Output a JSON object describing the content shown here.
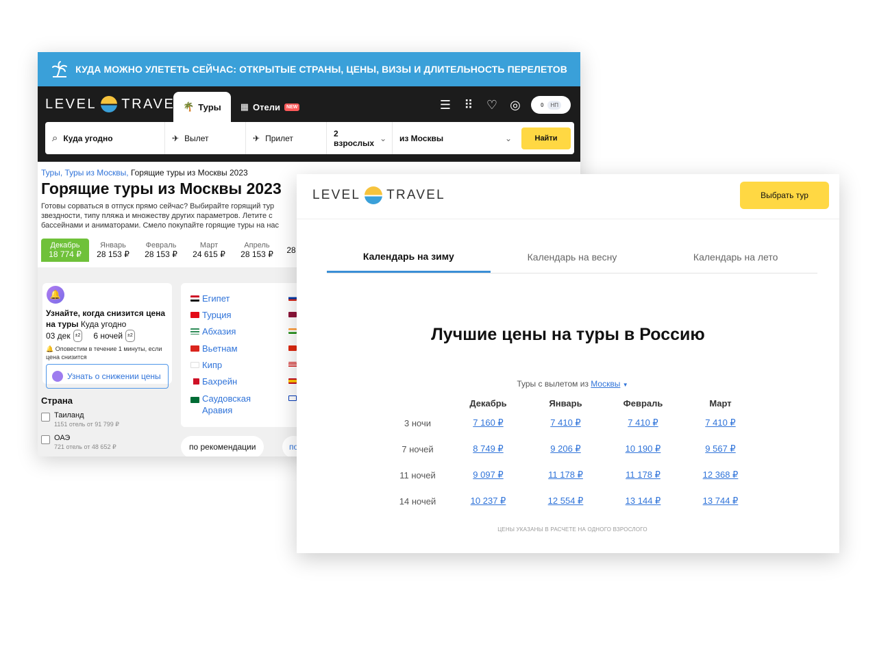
{
  "back_window": {
    "promo_banner": "КУДА МОЖНО УЛЕТЕТЬ СЕЙЧАС: ОТКРЫТЫЕ СТРАНЫ, ЦЕНЫ, ВИЗЫ И ДЛИТЕЛЬНОСТЬ ПЕРЕЛЕТОВ",
    "logo_left": "LEVEL",
    "logo_right": "TRAVEL",
    "tabs": {
      "tours": "Туры",
      "hotels": "Отели",
      "new_badge": "NEW"
    },
    "login": {
      "left": "0",
      "right": "НП"
    },
    "search": {
      "where": "Куда угодно",
      "departure": "Вылет",
      "arrival": "Прилет",
      "guests": "2 взрослых",
      "from_city": "из Москвы",
      "find": "Найти"
    },
    "breadcrumb": {
      "tours": "Туры,",
      "tours_moscow": "Туры из Москвы,",
      "current": "Горящие туры из Москвы 2023"
    },
    "title": "Горящие туры из Москвы 2023",
    "intro": "Готовы сорваться в отпуск прямо сейчас? Выбирайте горящий тур звездности, типу пляжа и множеству других параметров. Летите с бассейнами и аниматорами. Смело покупайте горящие туры на нас",
    "months": [
      {
        "name": "Декабрь",
        "price": "18 774 ₽"
      },
      {
        "name": "Январь",
        "price": "28 153 ₽"
      },
      {
        "name": "Февраль",
        "price": "28 153 ₽"
      },
      {
        "name": "Март",
        "price": "24 615 ₽"
      },
      {
        "name": "Апрель",
        "price": "28 153 ₽"
      },
      {
        "name": "",
        "price": "28"
      }
    ],
    "alert": {
      "title_bold": "Узнайте, когда снизится цена на туры",
      "title_rest": "Куда угодно",
      "date": "03 дек",
      "date_range": "±2",
      "nights": "6 ночей",
      "nights_range": "±2",
      "note": "Оповестим в течение 1 минуты, если цена снизится",
      "button": "Узнать о снижении цены"
    },
    "country_filter": {
      "heading": "Страна",
      "items": [
        {
          "name": "Таиланд",
          "sub": "1151 отель от 91 799 ₽"
        },
        {
          "name": "ОАЭ",
          "sub": "721 отель от 48 652 ₽"
        }
      ]
    },
    "destinations": [
      "Египет",
      "Турция",
      "Абхазия",
      "Вьетнам",
      "Кипр",
      "Бахрейн",
      "Саудовская",
      "Аравия"
    ],
    "sort": {
      "recommend": "по рекомендации",
      "other": "по"
    }
  },
  "front_window": {
    "logo_left": "LEVEL",
    "logo_right": "TRAVEL",
    "choose_button": "Выбрать тур",
    "season_tabs": [
      "Календарь на зиму",
      "Календарь на весну",
      "Календарь на лето"
    ],
    "title": "Лучшие цены на туры в Россию",
    "from_label": "Туры с вылетом из",
    "from_city": "Москвы",
    "columns": [
      "Декабрь",
      "Январь",
      "Февраль",
      "Март"
    ],
    "rows": [
      {
        "label": "3 ночи",
        "prices": [
          "7 160 ₽",
          "7 410 ₽",
          "7 410 ₽",
          "7 410 ₽"
        ]
      },
      {
        "label": "7 ночей",
        "prices": [
          "8 749 ₽",
          "9 206 ₽",
          "10 190 ₽",
          "9 567 ₽"
        ]
      },
      {
        "label": "11 ночей",
        "prices": [
          "9 097 ₽",
          "11 178 ₽",
          "11 178 ₽",
          "12 368 ₽"
        ]
      },
      {
        "label": "14 ночей",
        "prices": [
          "10 237 ₽",
          "12 554 ₽",
          "13 144 ₽",
          "13 744 ₽"
        ]
      }
    ],
    "note": "ЦЕНЫ УКАЗАНЫ В РАСЧЕТЕ НА ОДНОГО ВЗРОСЛОГО"
  },
  "colors": {
    "accent_blue": "#3aa0d9",
    "yellow": "#ffd843",
    "green": "#6fc13a",
    "link": "#2f73d9"
  }
}
